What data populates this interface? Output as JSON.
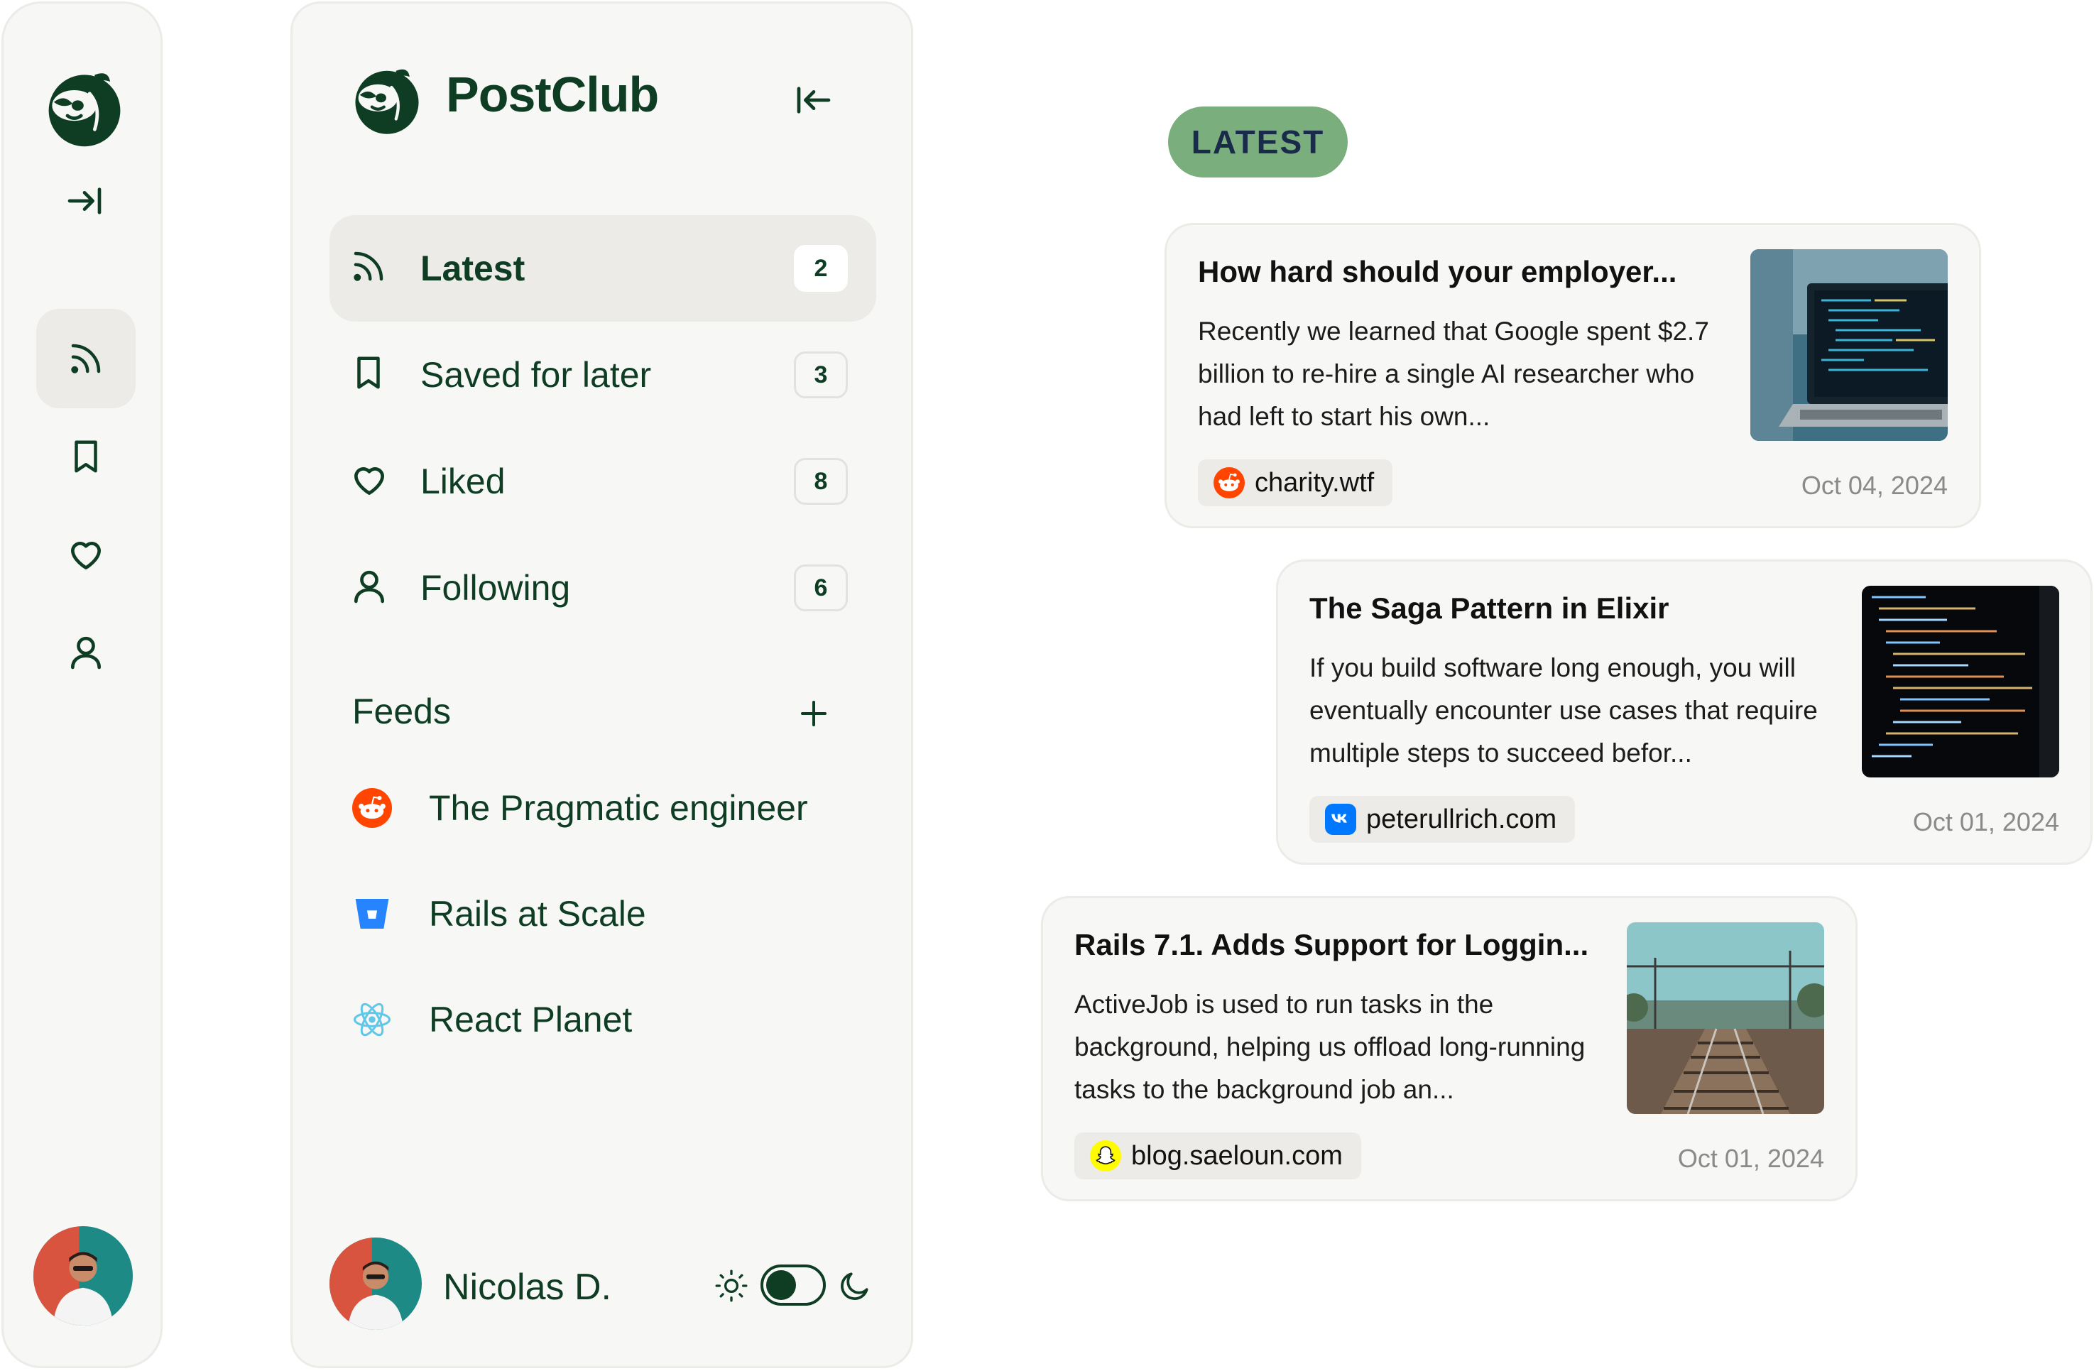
{
  "app": {
    "name": "PostClub"
  },
  "colors": {
    "brand": "#0f3d24",
    "accent_pill": "#7aae7d",
    "active_bg": "#ecebe7"
  },
  "nav": [
    {
      "id": "latest",
      "label": "Latest",
      "count": "2",
      "icon": "rss-icon",
      "active": true
    },
    {
      "id": "saved",
      "label": "Saved for later",
      "count": "3",
      "icon": "bookmark-icon",
      "active": false
    },
    {
      "id": "liked",
      "label": "Liked",
      "count": "8",
      "icon": "heart-icon",
      "active": false
    },
    {
      "id": "following",
      "label": "Following",
      "count": "6",
      "icon": "user-icon",
      "active": false
    }
  ],
  "feeds": {
    "title": "Feeds",
    "items": [
      {
        "label": "The Pragmatic engineer",
        "icon": "reddit-icon"
      },
      {
        "label": "Rails at Scale",
        "icon": "bitbucket-icon"
      },
      {
        "label": "React Planet",
        "icon": "react-icon"
      }
    ]
  },
  "user": {
    "name": "Nicolas D.",
    "theme": "dark-toggle"
  },
  "section_pill": "LATEST",
  "posts": [
    {
      "title": "How hard should your employer...",
      "text": "Recently we learned that Google spent $2.7 billion to re-hire a single AI researcher who had left to start his own...",
      "source": "charity.wtf",
      "source_icon": "reddit-icon",
      "date": "Oct 04, 2024"
    },
    {
      "title": "The Saga Pattern in Elixir",
      "text": "If you build software long enough, you will eventually encounter use cases that require multiple steps to succeed befor...",
      "source": "peterullrich.com",
      "source_icon": "vk-icon",
      "date": "Oct 01, 2024"
    },
    {
      "title": "Rails 7.1. Adds Support for Loggin...",
      "text": "ActiveJob is used to run tasks in the background, helping us offload long-running tasks to the background job an...",
      "source": "blog.saeloun.com",
      "source_icon": "snapchat-icon",
      "date": "Oct 01, 2024"
    }
  ]
}
